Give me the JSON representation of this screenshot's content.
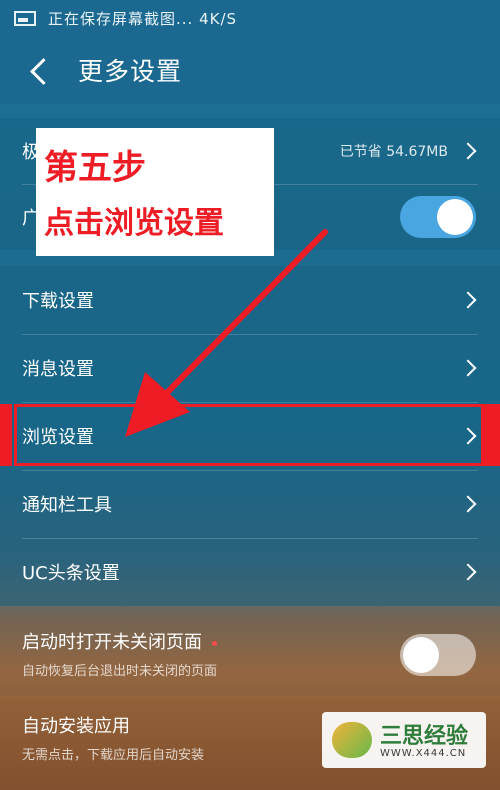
{
  "status_bar": {
    "text": "正在保存屏幕截图...",
    "speed": "4K/S"
  },
  "header": {
    "title": "更多设置"
  },
  "group1": {
    "row1": {
      "label": "极",
      "value": "已节省 54.67MB"
    },
    "row2": {
      "label": "广"
    }
  },
  "group2": {
    "items": [
      {
        "label": "下载设置"
      },
      {
        "label": "消息设置"
      },
      {
        "label": "浏览设置"
      },
      {
        "label": "通知栏工具"
      },
      {
        "label": "UC头条设置"
      }
    ]
  },
  "group3": {
    "label": "启动时打开未关闭页面",
    "sub": "自动恢复后台退出时未关闭的页面"
  },
  "group4": {
    "label": "自动安装应用",
    "sub": "无需点击，下载应用后自动安装"
  },
  "annotation": {
    "step": "第五步",
    "desc": "点击浏览设置"
  },
  "watermark": {
    "title": "三思经验",
    "url": "WWW.X444.CN"
  },
  "colors": {
    "accent_red": "#ee1c24",
    "toggle_on": "#4aa6e0",
    "header": "#1b6990"
  },
  "toggles": {
    "row2_on": true,
    "group3_on": false
  }
}
